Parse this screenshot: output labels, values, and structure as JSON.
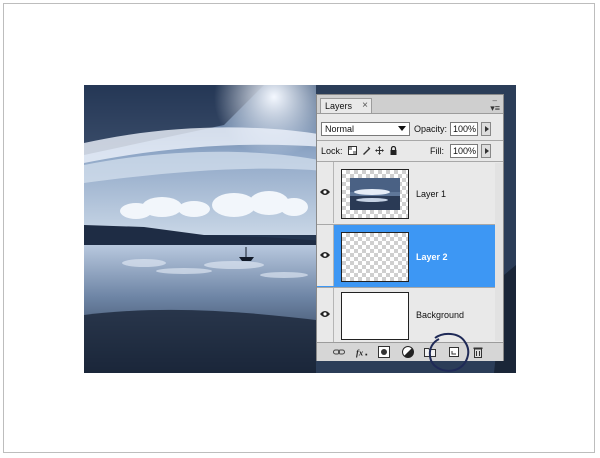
{
  "panel": {
    "tab_label": "Layers",
    "tab_close": "×",
    "collapse_glyph": "–",
    "menu_glyph": "▾≡"
  },
  "blend": {
    "mode": "Normal"
  },
  "opacity": {
    "label": "Opacity:",
    "value": "100%"
  },
  "lock": {
    "label": "Lock:"
  },
  "fill": {
    "label": "Fill:",
    "value": "100%"
  },
  "layers": [
    {
      "name": "Layer 1",
      "visible": true,
      "selected": false,
      "thumbnail": "photo"
    },
    {
      "name": "Layer 2",
      "visible": true,
      "selected": true,
      "thumbnail": "transparent"
    },
    {
      "name": "Background",
      "visible": true,
      "selected": false,
      "thumbnail": "white"
    }
  ],
  "bottom_icons": [
    "link-layers-icon",
    "fx-layer-style-icon",
    "add-mask-icon",
    "adjustment-layer-icon",
    "new-group-icon",
    "new-layer-icon",
    "delete-layer-icon"
  ],
  "colors": {
    "selected": "#3d97f4",
    "panel": "#e9e9e9",
    "annotation_circle": "#1f2a57"
  }
}
